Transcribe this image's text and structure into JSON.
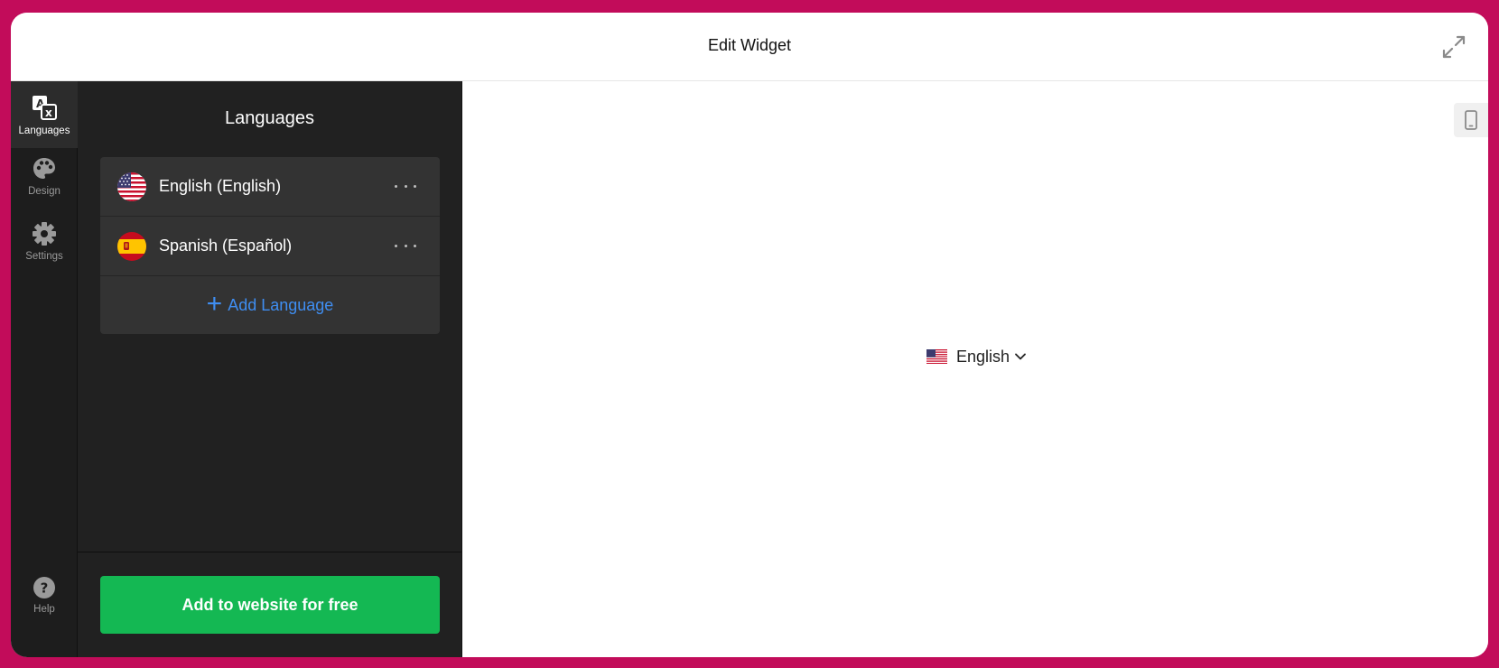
{
  "header": {
    "title": "Edit Widget",
    "expand_icon": "expand-arrows-icon"
  },
  "iconbar": {
    "items": [
      {
        "label": "Languages",
        "icon": "translate-icon",
        "active": true
      },
      {
        "label": "Design",
        "icon": "palette-icon",
        "active": false
      },
      {
        "label": "Settings",
        "icon": "gear-icon",
        "active": false
      }
    ],
    "help": {
      "label": "Help",
      "icon": "question-icon"
    }
  },
  "panel": {
    "title": "Languages",
    "languages": [
      {
        "label": "English (English)",
        "flag": "us-flag-icon"
      },
      {
        "label": "Spanish (Español)",
        "flag": "es-flag-icon"
      }
    ],
    "add_label": "Add Language",
    "cta_label": "Add to website for free"
  },
  "preview": {
    "device_icon": "mobile-icon",
    "switcher": {
      "label": "English",
      "flag": "us-flag-icon"
    }
  },
  "colors": {
    "frame": "#c20c5a",
    "accent_blue": "#3f8ef2",
    "cta_green": "#14b853",
    "sidebar_dark": "#1d1d1d",
    "panel_dark": "#212121"
  }
}
